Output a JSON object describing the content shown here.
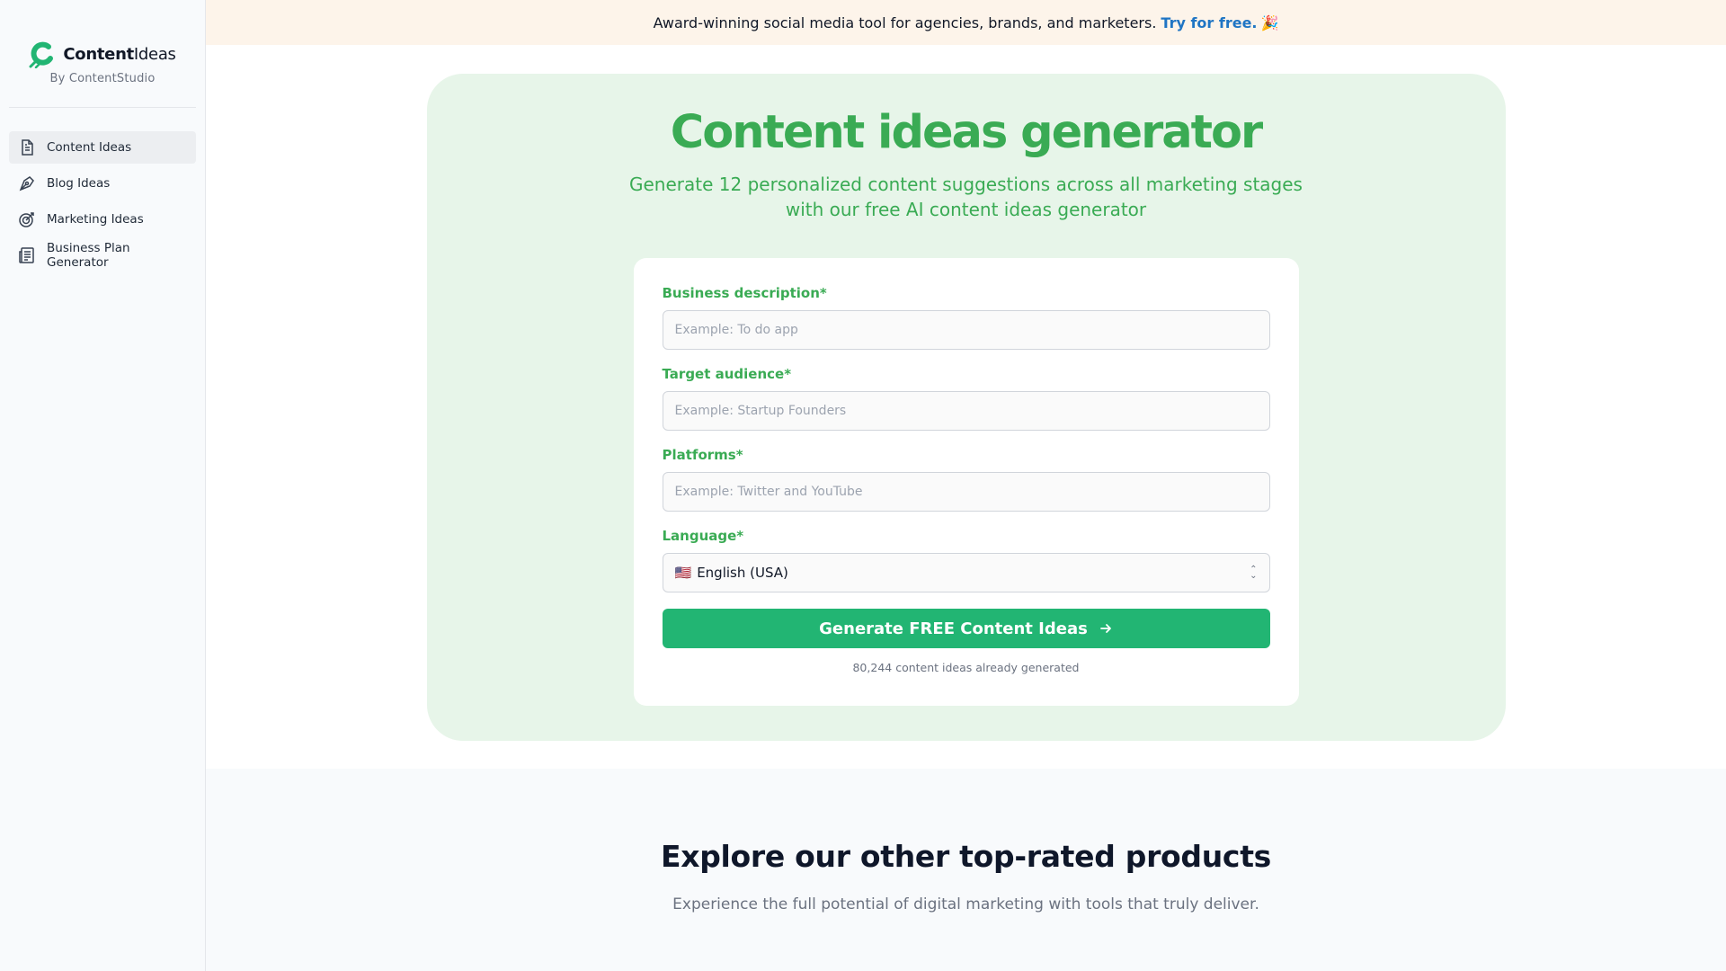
{
  "brand": {
    "name_bold": "Content",
    "name_light": "Ideas",
    "subtitle": "By ContentStudio",
    "accent": "#3aab54"
  },
  "sidebar": {
    "items": [
      {
        "label": "Content Ideas",
        "icon": "document-icon",
        "active": true
      },
      {
        "label": "Blog Ideas",
        "icon": "pen-nib-icon",
        "active": false
      },
      {
        "label": "Marketing Ideas",
        "icon": "target-icon",
        "active": false
      },
      {
        "label": "Business Plan Generator",
        "icon": "newspaper-icon",
        "active": false
      }
    ]
  },
  "banner": {
    "text": "Award-winning social media tool for agencies, brands, and marketers.",
    "link": "Try for free.",
    "emoji": "🎉",
    "link_color": "#1f75c4"
  },
  "hero": {
    "title": "Content ideas generator",
    "subtitle": "Generate 12 personalized content suggestions across all marketing stages with our free AI content ideas generator"
  },
  "form": {
    "business": {
      "label": "Business description*",
      "placeholder": "Example: To do app",
      "value": ""
    },
    "audience": {
      "label": "Target audience*",
      "placeholder": "Example: Startup Founders",
      "value": ""
    },
    "platforms": {
      "label": "Platforms*",
      "placeholder": "Example: Twitter and YouTube",
      "value": ""
    },
    "language": {
      "label": "Language*",
      "flag": "🇺🇸",
      "selected": "English (USA)"
    },
    "submit_label": "Generate FREE Content Ideas",
    "button_color": "#22b573",
    "counter": "80,244 content ideas already generated"
  },
  "explore": {
    "title": "Explore our other top-rated products",
    "subtitle": "Experience the full potential of digital marketing with tools that truly deliver."
  }
}
